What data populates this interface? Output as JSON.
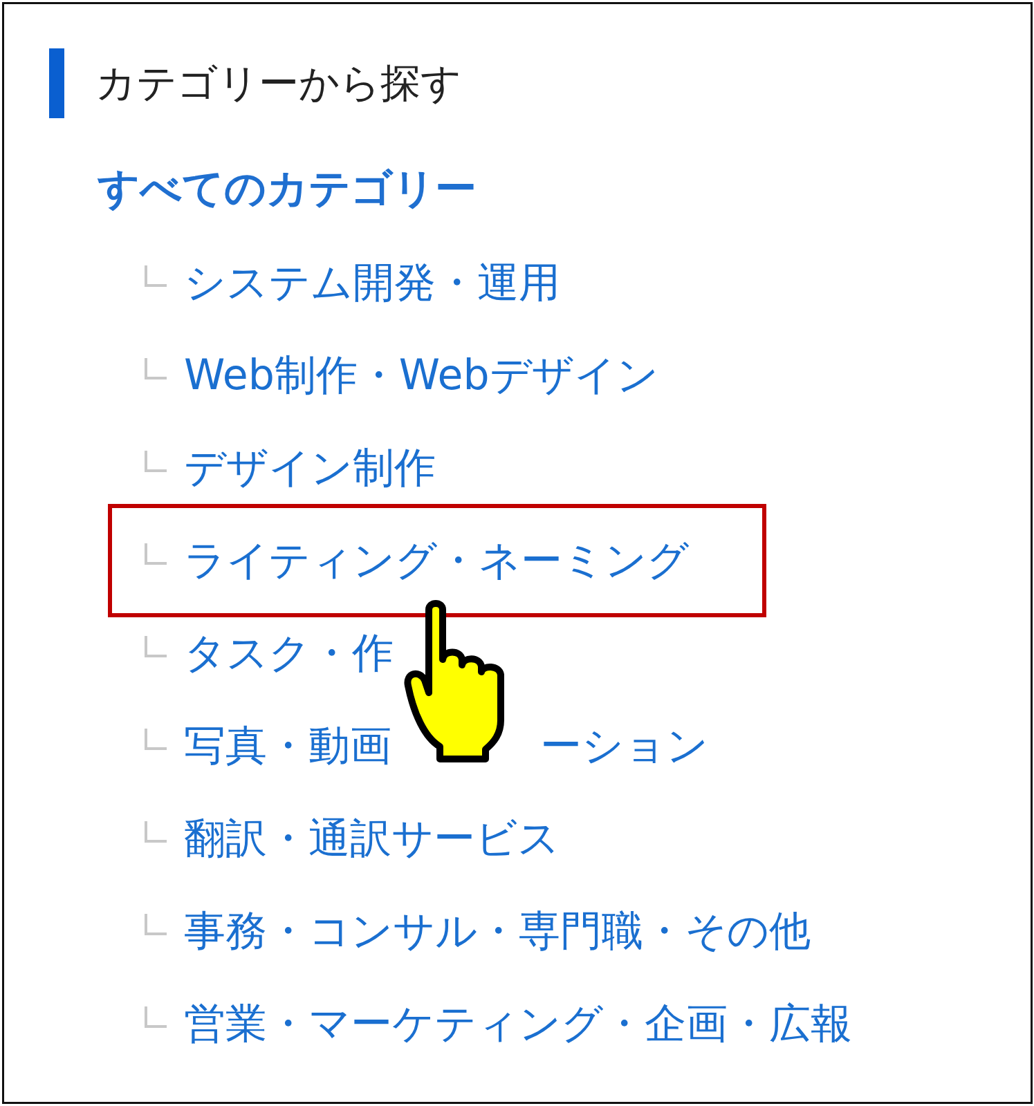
{
  "panel": {
    "title": "カテゴリーから探す"
  },
  "all_link": "すべてのカテゴリー",
  "categories": [
    {
      "label": "システム開発・運用",
      "selected": false
    },
    {
      "label": "Web制作・Webデザイン",
      "selected": false
    },
    {
      "label": "デザイン制作",
      "selected": false
    },
    {
      "label": "ライティング・ネーミング",
      "selected": true
    },
    {
      "label": "タスク・作",
      "selected": false
    },
    {
      "label": "写真・動画",
      "label_continued": "ーション",
      "selected": false
    },
    {
      "label": "翻訳・通訳サービス",
      "selected": false
    },
    {
      "label": "事務・コンサル・専門職・その他",
      "selected": false
    },
    {
      "label": "営業・マーケティング・企画・広報",
      "selected": false
    }
  ]
}
